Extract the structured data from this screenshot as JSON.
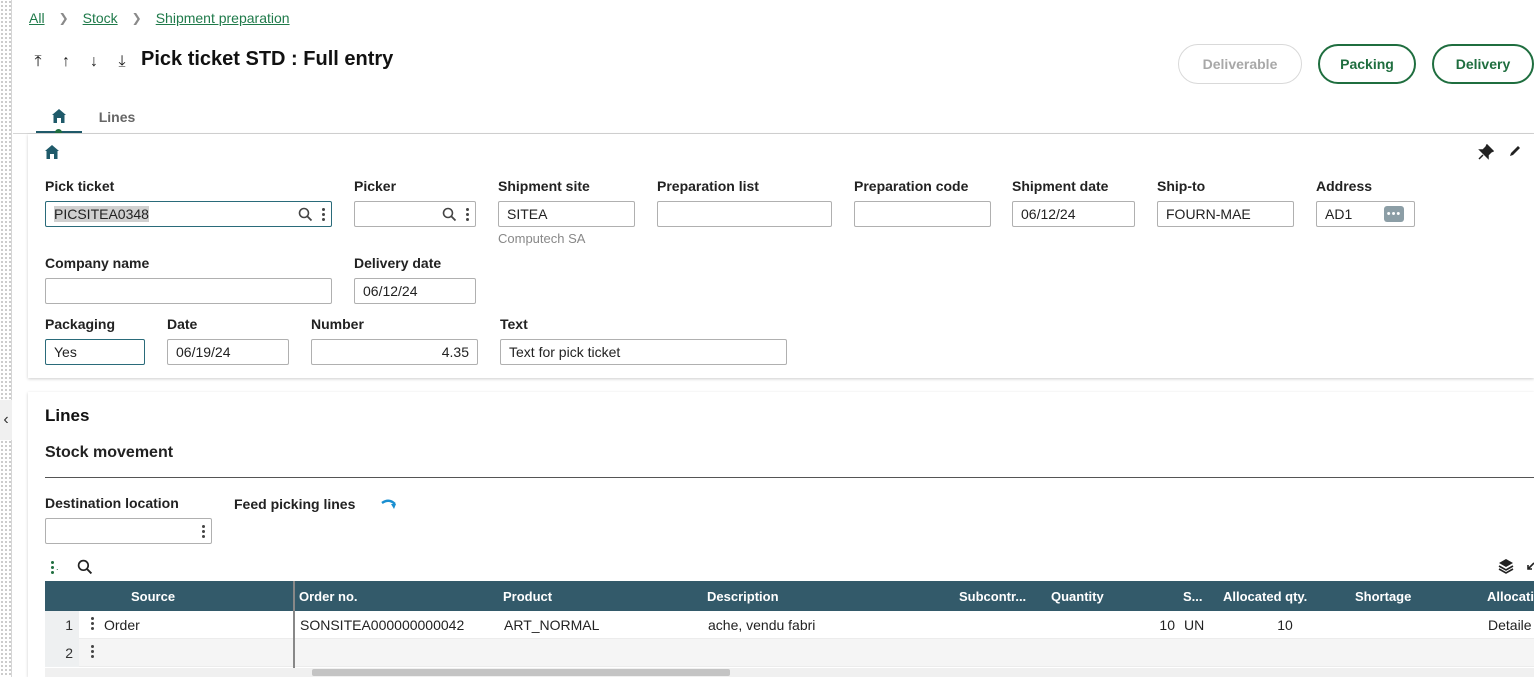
{
  "breadcrumb": {
    "all": "All",
    "stock": "Stock",
    "shipment_preparation": "Shipment preparation"
  },
  "nav_arrows": {
    "first": "⤒",
    "prev": "↑",
    "next": "↓",
    "last": "⤓"
  },
  "page_title": "Pick ticket STD : Full entry",
  "actions": {
    "deliverable": "Deliverable",
    "packing": "Packing",
    "delivery": "Delivery"
  },
  "tabs": {
    "lines": "Lines"
  },
  "form": {
    "pick_ticket": {
      "label": "Pick ticket",
      "value": "PICSITEA0348"
    },
    "picker": {
      "label": "Picker",
      "value": ""
    },
    "shipment_site": {
      "label": "Shipment site",
      "value": "SITEA",
      "sub": "Computech SA"
    },
    "preparation_list": {
      "label": "Preparation list",
      "value": ""
    },
    "preparation_code": {
      "label": "Preparation code",
      "value": ""
    },
    "shipment_date": {
      "label": "Shipment date",
      "value": "06/12/24"
    },
    "ship_to": {
      "label": "Ship-to",
      "value": "FOURN-MAE"
    },
    "address": {
      "label": "Address",
      "value": "AD1"
    },
    "company_name": {
      "label": "Company name",
      "value": ""
    },
    "delivery_date": {
      "label": "Delivery date",
      "value": "06/12/24"
    },
    "packaging": {
      "label": "Packaging",
      "value": "Yes"
    },
    "date": {
      "label": "Date",
      "value": "06/19/24"
    },
    "number": {
      "label": "Number",
      "value": "4.35"
    },
    "text": {
      "label": "Text",
      "value": "Text for pick ticket"
    }
  },
  "lines_section": {
    "title": "Lines",
    "subtitle": "Stock movement",
    "destination_location": {
      "label": "Destination location",
      "value": ""
    },
    "feed_picking_lines": "Feed picking lines"
  },
  "table": {
    "headers": {
      "source": "Source",
      "order_no": "Order no.",
      "product": "Product",
      "description": "Description",
      "subcontr": "Subcontr...",
      "quantity": "Quantity",
      "s": "S...",
      "allocated_qty": "Allocated qty.",
      "shortage": "Shortage",
      "allocation": "Allocatio"
    },
    "rows": [
      {
        "num": "1",
        "source": "Order",
        "order_no": "SONSITEA000000000042",
        "product": "ART_NORMAL",
        "description": "ache, vendu fabri",
        "subcontr": "",
        "quantity": "10",
        "s": "UN",
        "allocated_qty": "10",
        "shortage": "",
        "allocation": "Detaile"
      },
      {
        "num": "2",
        "source": "",
        "order_no": "",
        "product": "",
        "description": "",
        "subcontr": "",
        "quantity": "",
        "s": "",
        "allocated_qty": "",
        "shortage": "",
        "allocation": ""
      }
    ]
  },
  "colors": {
    "brand_green": "#1f6e3f",
    "header_teal": "#335a6a",
    "link_green": "#1f7a4a"
  }
}
